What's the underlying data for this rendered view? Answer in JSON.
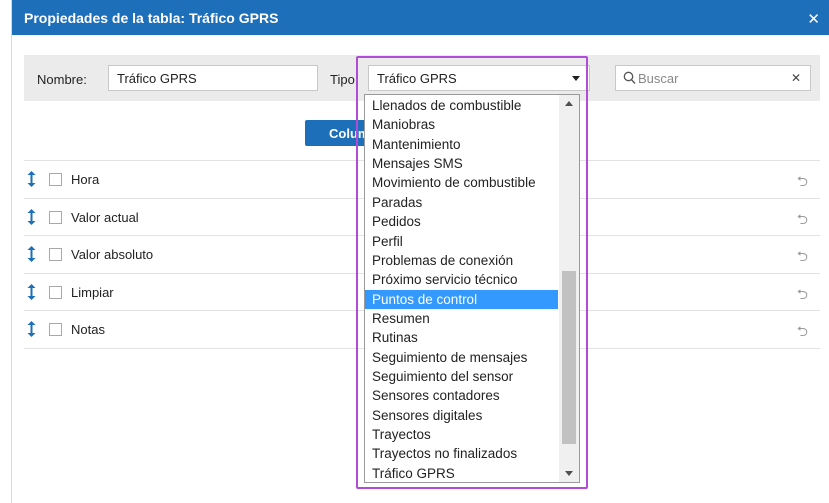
{
  "dialog": {
    "title": "Propiedades de la tabla: Tráfico GPRS",
    "close_icon": "close-icon"
  },
  "filter": {
    "name_label": "Nombre:",
    "name_value": "Tráfico GPRS",
    "type_label": "Tipo:",
    "type_value": "Tráfico GPRS",
    "search_placeholder": "Buscar",
    "search_icon": "search-icon",
    "clear_icon": "close-icon"
  },
  "columns_button": {
    "label": "Columnas"
  },
  "rows": [
    {
      "label": "Hora",
      "drag_icon": "drag-handle-icon",
      "reset_icon": "undo-icon"
    },
    {
      "label": "Valor actual",
      "drag_icon": "drag-handle-icon",
      "reset_icon": "undo-icon"
    },
    {
      "label": "Valor absoluto",
      "drag_icon": "drag-handle-icon",
      "reset_icon": "undo-icon"
    },
    {
      "label": "Limpiar",
      "drag_icon": "drag-handle-icon",
      "reset_icon": "undo-icon"
    },
    {
      "label": "Notas",
      "drag_icon": "drag-handle-icon",
      "reset_icon": "undo-icon"
    }
  ],
  "dropdown": {
    "selected_index": 10,
    "items": [
      "Llenados de combustible",
      "Maniobras",
      "Mantenimiento",
      "Mensajes SMS",
      "Movimiento de combustible",
      "Paradas",
      "Pedidos",
      "Perfil",
      "Problemas de conexión",
      "Próximo servicio técnico",
      "Puntos de control",
      "Resumen",
      "Rutinas",
      "Seguimiento de mensajes",
      "Seguimiento del sensor",
      "Sensores contadores",
      "Sensores digitales",
      "Trayectos",
      "Trayectos no finalizados",
      "Tráfico GPRS"
    ]
  },
  "colors": {
    "titlebar": "#1e6fba",
    "accent": "#1e6fba",
    "selected_item": "#3399ff",
    "highlight_border": "#b04dd6",
    "filter_bg": "#ebebeb"
  }
}
